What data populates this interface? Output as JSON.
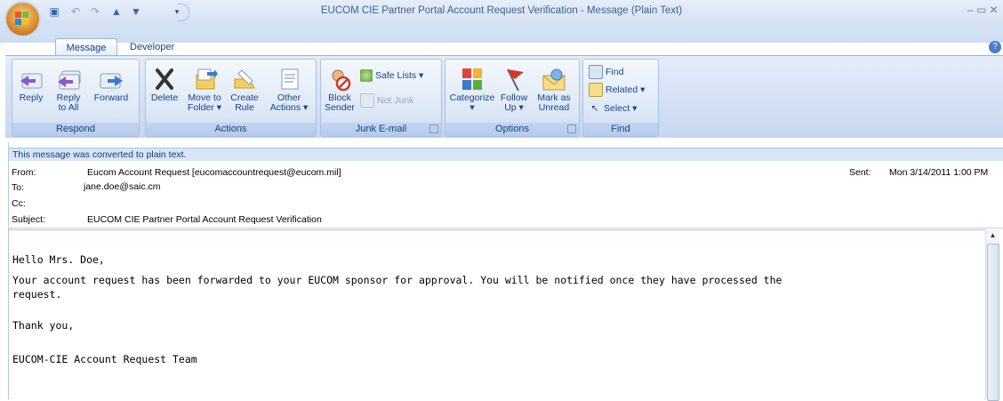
{
  "window": {
    "title": "EUCOM CIE Partner Portal Account Request Verification - Message (Plain Text)",
    "controls": "–  ▭  ✕"
  },
  "tabs": [
    {
      "label": "Message"
    },
    {
      "label": "Developer"
    }
  ],
  "ribbon": {
    "respond": {
      "label": "Respond",
      "reply": "Reply",
      "reply_all_1": "Reply",
      "reply_all_2": "to All",
      "forward": "Forward"
    },
    "actions": {
      "label": "Actions",
      "delete": "Delete",
      "move_1": "Move to",
      "move_2": "Folder ▾",
      "create_1": "Create",
      "create_2": "Rule",
      "other_1": "Other",
      "other_2": "Actions ▾"
    },
    "junk": {
      "label": "Junk E-mail",
      "block_1": "Block",
      "block_2": "Sender",
      "safe_lists": "Safe Lists ▾",
      "not_junk": "Not Junk"
    },
    "options": {
      "label": "Options",
      "categorize_1": "Categorize",
      "categorize_2": "▾",
      "follow_1": "Follow",
      "follow_2": "Up ▾",
      "unread_1": "Mark as",
      "unread_2": "Unread"
    },
    "find": {
      "label": "Find",
      "find": "Find",
      "related": "Related ▾",
      "select": "Select ▾"
    }
  },
  "infobar": "This message was converted to plain text.",
  "header": {
    "from_label": "From:",
    "from_value": "Eucom Account Request [eucomaccountrequest@eucom.mil]",
    "to_label": "To:",
    "to_value": "jane.doe@saic.cm",
    "cc_label": "Cc:",
    "subject_label": "Subject:",
    "subject_value": "EUCOM CIE Partner Portal Account Request Verification",
    "sent_label": "Sent:",
    "sent_value": "Mon 3/14/2011 1:00 PM"
  },
  "body": {
    "greeting": "Hello Mrs. Doe,",
    "line1": "Your account request has been forwarded to your EUCOM sponsor for approval. You will be notified once they have processed the",
    "line2": "request.",
    "thanks": "Thank you,",
    "signature": "EUCOM-CIE Account Request Team"
  }
}
